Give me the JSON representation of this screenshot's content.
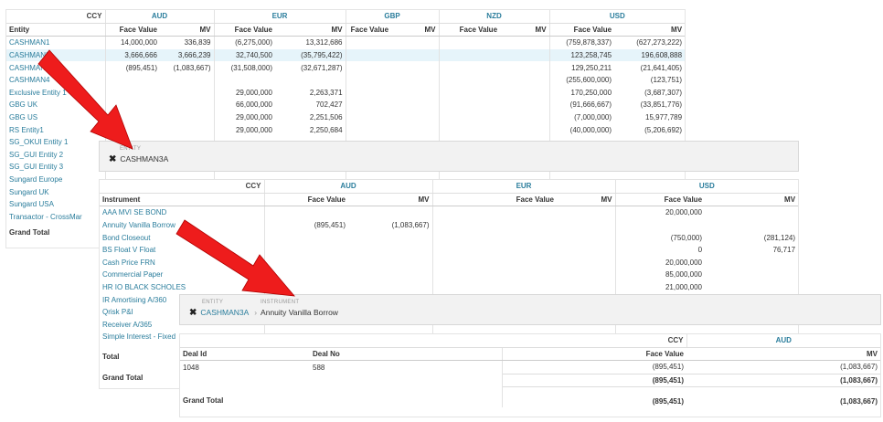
{
  "colors": {
    "accent": "#2a7d9c",
    "arrow": "#ee1c1c"
  },
  "top": {
    "ccy_label": "CCY",
    "currencies": [
      "AUD",
      "EUR",
      "GBP",
      "NZD",
      "USD"
    ],
    "entity_header": "Entity",
    "fv": "Face Value",
    "mv": "MV",
    "rows": [
      {
        "name": "CASHMAN1",
        "v": [
          "14,000,000",
          "336,839",
          "(6,275,000)",
          "13,312,686",
          "",
          "",
          "",
          "",
          "(759,878,337)",
          "(627,273,222)"
        ]
      },
      {
        "name": "CASHMAN2",
        "v": [
          "3,666,666",
          "3,666,239",
          "32,740,500",
          "(35,795,422)",
          "",
          "",
          "",
          "",
          "123,258,745",
          "196,608,888"
        ]
      },
      {
        "name": "CASHMAN3",
        "v": [
          "(895,451)",
          "(1,083,667)",
          "(31,508,000)",
          "(32,671,287)",
          "",
          "",
          "",
          "",
          "129,250,211",
          "(21,641,405)"
        ]
      },
      {
        "name": "CASHMAN4",
        "v": [
          "",
          "",
          "",
          "",
          "",
          "",
          "",
          "",
          "(255,600,000)",
          "(123,751)"
        ]
      },
      {
        "name": "Exclusive Entity 1",
        "v": [
          "",
          "",
          "29,000,000",
          "2,263,371",
          "",
          "",
          "",
          "",
          "170,250,000",
          "(3,687,307)"
        ]
      },
      {
        "name": "GBG UK",
        "v": [
          "",
          "",
          "66,000,000",
          "702,427",
          "",
          "",
          "",
          "",
          "(91,666,667)",
          "(33,851,776)"
        ]
      },
      {
        "name": "GBG US",
        "v": [
          "",
          "",
          "29,000,000",
          "2,251,506",
          "",
          "",
          "",
          "",
          "(7,000,000)",
          "15,977,789"
        ]
      },
      {
        "name": "RS Entity1",
        "v": [
          "",
          "",
          "29,000,000",
          "2,250,684",
          "",
          "",
          "",
          "",
          "(40,000,000)",
          "(5,206,692)"
        ]
      },
      {
        "name": "SG_OKUI Entity 1",
        "v": [
          "",
          "",
          "",
          "",
          "",
          "",
          "",
          "",
          "",
          ""
        ]
      },
      {
        "name": "SG_GUI Entity 2",
        "v": [
          "",
          "",
          "",
          "",
          "",
          "",
          "",
          "",
          "",
          ""
        ]
      },
      {
        "name": "SG_GUI Entity 3",
        "v": [
          "",
          "",
          "",
          "",
          "",
          "",
          "",
          "",
          "",
          ""
        ]
      },
      {
        "name": "Sungard Europe",
        "v": [
          "",
          "",
          "",
          "",
          "",
          "",
          "",
          "",
          "",
          ""
        ]
      },
      {
        "name": "Sungard UK",
        "v": [
          "",
          "",
          "",
          "",
          "",
          "",
          "",
          "",
          "",
          ""
        ]
      },
      {
        "name": "Sungard USA",
        "v": [
          "",
          "",
          "",
          "",
          "",
          "",
          "",
          "",
          "",
          ""
        ]
      },
      {
        "name": "Transactor - CrossMar",
        "v": [
          "",
          "",
          "",
          "",
          "",
          "",
          "",
          "",
          "",
          ""
        ]
      }
    ],
    "grand_total": "Grand Total"
  },
  "bc1": {
    "caption": "ENTITY",
    "value": "CASHMAN3A"
  },
  "mid": {
    "ccy_label": "CCY",
    "currencies": [
      "AUD",
      "EUR",
      "USD"
    ],
    "instrument_header": "Instrument",
    "fv": "Face Value",
    "mv": "MV",
    "rows": [
      {
        "name": "AAA MVI SE BOND",
        "v": [
          "",
          "",
          "",
          "",
          "20,000,000",
          ""
        ]
      },
      {
        "name": "Annuity Vanilla Borrow",
        "v": [
          "(895,451)",
          "(1,083,667)",
          "",
          "",
          "",
          ""
        ]
      },
      {
        "name": "Bond Closeout",
        "v": [
          "",
          "",
          "",
          "",
          "(750,000)",
          "(281,124)"
        ]
      },
      {
        "name": "BS Float V Float",
        "v": [
          "",
          "",
          "",
          "",
          "0",
          "76,717"
        ]
      },
      {
        "name": "Cash Price FRN",
        "v": [
          "",
          "",
          "",
          "",
          "20,000,000",
          ""
        ]
      },
      {
        "name": "Commercial Paper",
        "v": [
          "",
          "",
          "",
          "",
          "85,000,000",
          ""
        ]
      },
      {
        "name": "HR IO BLACK SCHOLES",
        "v": [
          "",
          "",
          "",
          "",
          "21,000,000",
          ""
        ]
      },
      {
        "name": "IR Amortising A/360",
        "v": [
          "",
          "",
          "",
          "",
          "",
          ""
        ]
      },
      {
        "name": "Qrisk P&I",
        "v": [
          "",
          "",
          "",
          "",
          "",
          ""
        ]
      },
      {
        "name": "Receiver A/365",
        "v": [
          "",
          "",
          "",
          "",
          "",
          ""
        ]
      },
      {
        "name": "Simple Interest - Fixed",
        "v": [
          "",
          "",
          "",
          "",
          "",
          ""
        ]
      }
    ],
    "total": "Total",
    "grand_total": "Grand Total"
  },
  "bc2": {
    "cap1": "ENTITY",
    "cap2": "INSTRUMENT",
    "v1": "CASHMAN3A",
    "sep": "›",
    "v2": "Annuity Vanilla Borrow"
  },
  "bot": {
    "ccy_label": "CCY",
    "currency": "AUD",
    "deal_id": "Deal Id",
    "deal_no": "Deal No",
    "fv": "Face Value",
    "mv": "MV",
    "row": {
      "id": "1048",
      "no": "588",
      "fv": "(895,451)",
      "mv": "(1,083,667)"
    },
    "subtotal": {
      "fv": "(895,451)",
      "mv": "(1,083,667)"
    },
    "grand_total": "Grand Total",
    "gt": {
      "fv": "(895,451)",
      "mv": "(1,083,667)"
    }
  }
}
